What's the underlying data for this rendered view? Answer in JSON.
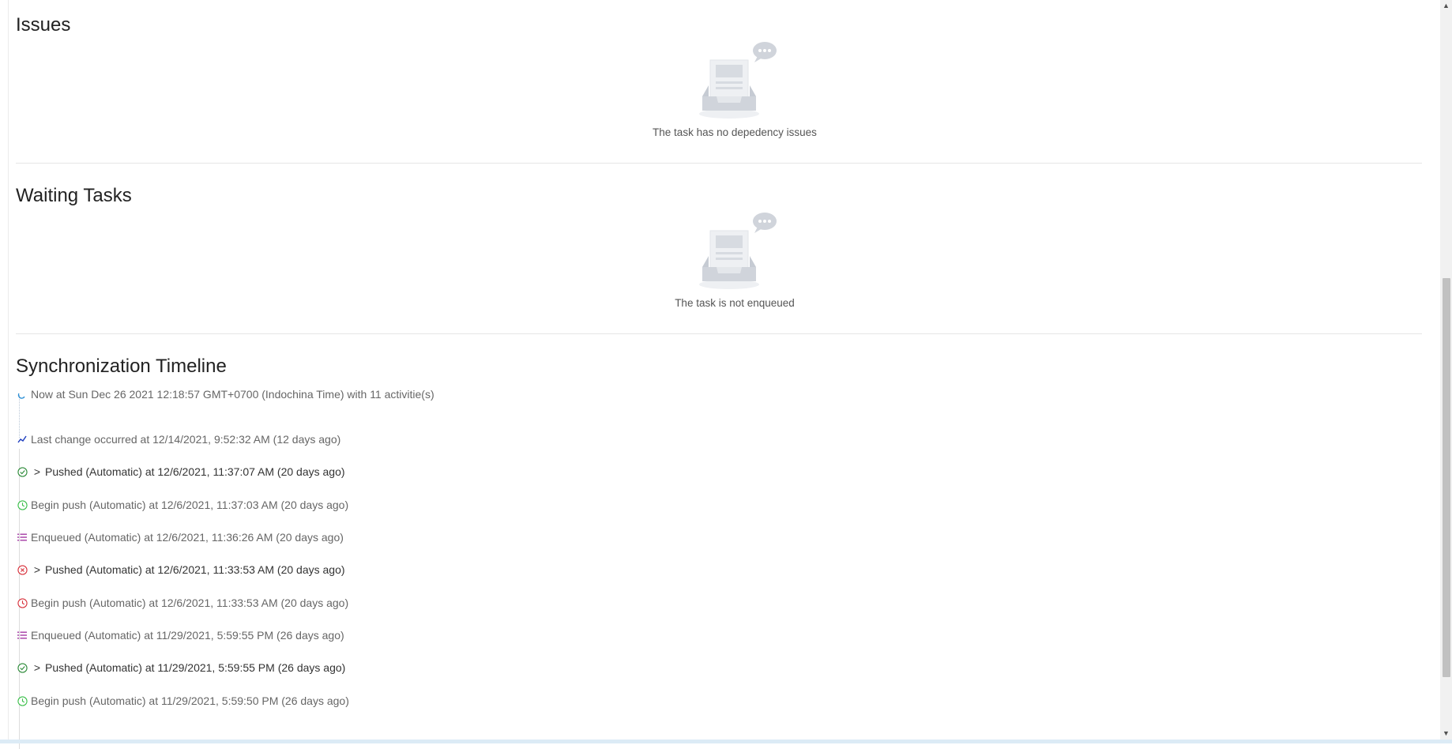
{
  "issues": {
    "title": "Issues",
    "empty_text": "The task has no depedency issues",
    "icon": "empty-inbox-icon"
  },
  "waiting": {
    "title": "Waiting Tasks",
    "empty_text": "The task is not enqueued",
    "icon": "empty-inbox-icon"
  },
  "timeline": {
    "title": "Synchronization Timeline",
    "now": "Now at Sun Dec 26 2021 12:18:57 GMT+0700 (Indochina Time) with 11 activitie(s)",
    "items": [
      {
        "kind": "change",
        "text": "Last change occurred at 12/14/2021, 9:52:32 AM (12 days ago)",
        "color": "#1f3fbf",
        "expandable": false
      },
      {
        "kind": "pushed-ok",
        "text": "Pushed (Automatic) at 12/6/2021, 11:37:07 AM (20 days ago)",
        "color": "#2e8b3a",
        "expandable": true
      },
      {
        "kind": "begin-ok",
        "text": "Begin push (Automatic) at 12/6/2021, 11:37:03 AM (20 days ago)",
        "color": "#3bbf4a",
        "expandable": false
      },
      {
        "kind": "enqueued",
        "text": "Enqueued (Automatic) at 12/6/2021, 11:36:26 AM (20 days ago)",
        "color": "#a63ca6",
        "expandable": false
      },
      {
        "kind": "pushed-fail",
        "text": "Pushed (Automatic) at 12/6/2021, 11:33:53 AM (20 days ago)",
        "color": "#d8323c",
        "expandable": true
      },
      {
        "kind": "begin-fail",
        "text": "Begin push (Automatic) at 12/6/2021, 11:33:53 AM (20 days ago)",
        "color": "#d8323c",
        "expandable": false
      },
      {
        "kind": "enqueued",
        "text": "Enqueued (Automatic) at 11/29/2021, 5:59:55 PM (26 days ago)",
        "color": "#a63ca6",
        "expandable": false
      },
      {
        "kind": "pushed-ok",
        "text": "Pushed (Automatic) at 11/29/2021, 5:59:55 PM (26 days ago)",
        "color": "#2e8b3a",
        "expandable": true
      },
      {
        "kind": "begin-ok",
        "text": "Begin push (Automatic) at 11/29/2021, 5:59:50 PM (26 days ago)",
        "color": "#3bbf4a",
        "expandable": false
      }
    ]
  },
  "scrollbar": {
    "up_glyph": "▲",
    "down_glyph": "▼"
  }
}
